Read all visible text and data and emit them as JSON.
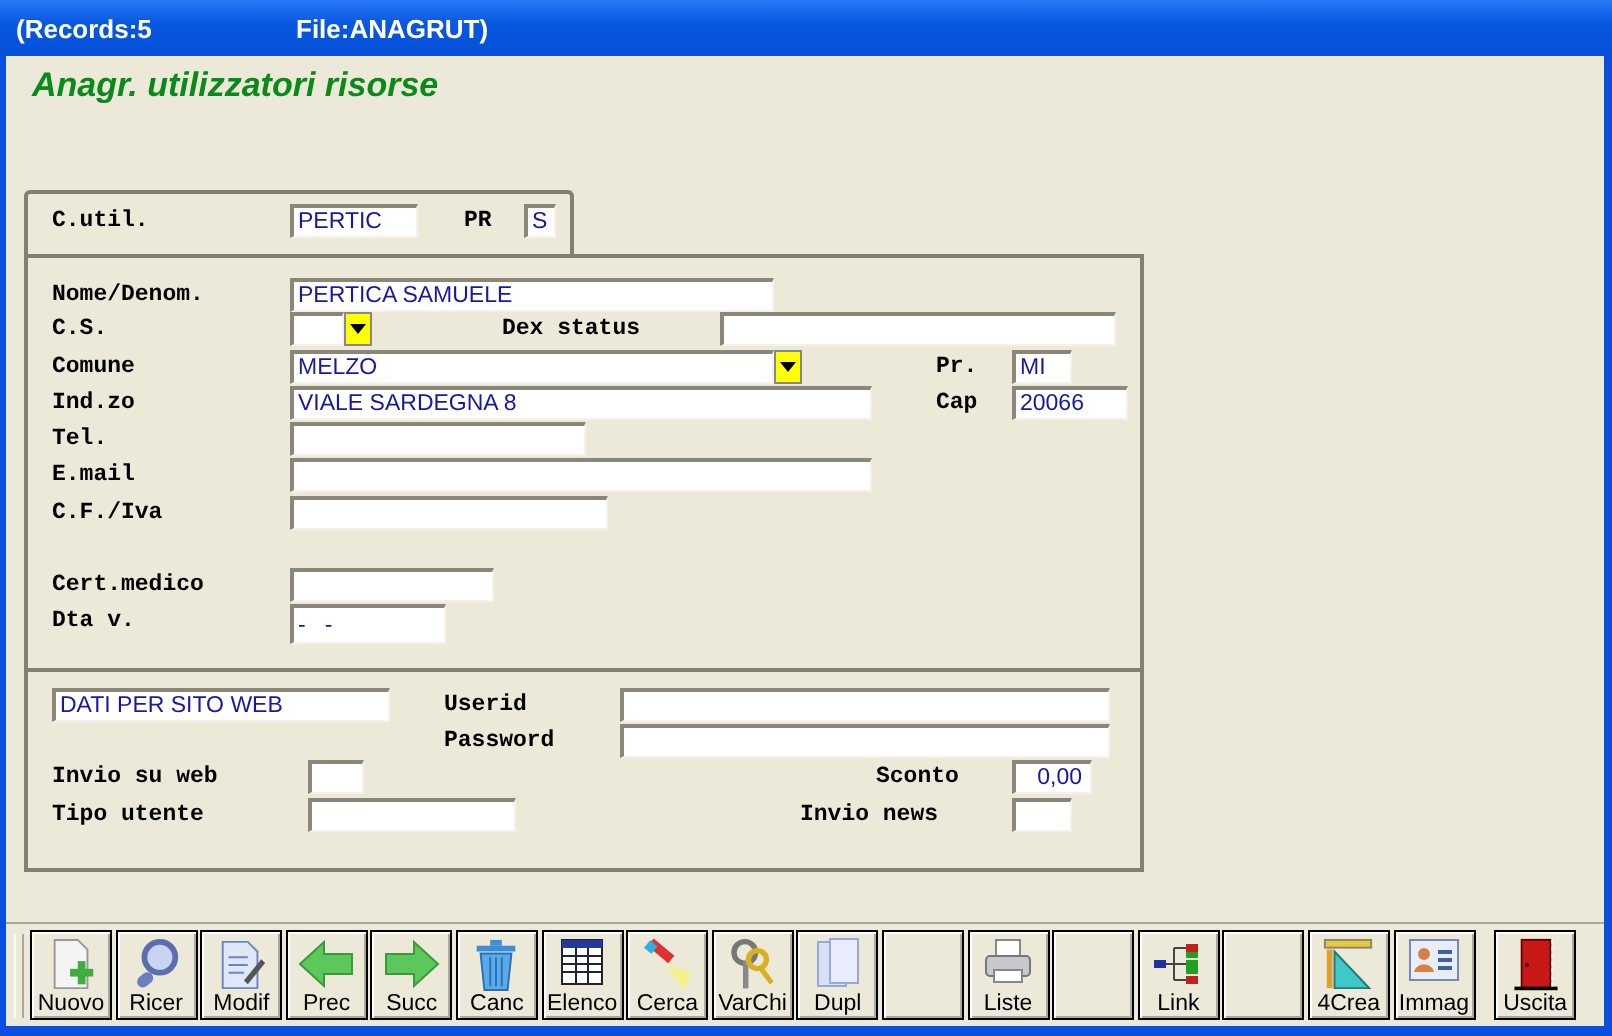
{
  "window": {
    "records": "(Records:5",
    "file": "File:ANAGRUT)"
  },
  "heading": "Anagr. utilizzatori risorse",
  "key_panel": {
    "rows": [
      [
        {
          "kind": "label",
          "text": "C.util."
        },
        {
          "kind": "field",
          "value": "PERTIC"
        },
        {
          "kind": "label",
          "text": "PR"
        },
        {
          "kind": "field",
          "value": "S"
        }
      ]
    ]
  },
  "detail_panel": {
    "rows": [
      [
        {
          "kind": "label",
          "text": "Nome/Denom."
        },
        {
          "kind": "field",
          "value": "PERTICA SAMUELE"
        }
      ],
      [
        {
          "kind": "label",
          "text": "C.S."
        },
        {
          "kind": "field"
        },
        {
          "kind": "dropdown"
        },
        {
          "kind": "label",
          "text": "Dex status"
        },
        {
          "kind": "field"
        }
      ],
      [
        {
          "kind": "label",
          "text": "Comune"
        },
        {
          "kind": "field",
          "value": "MELZO"
        },
        {
          "kind": "dropdown"
        },
        {
          "kind": "label",
          "text": "Pr."
        },
        {
          "kind": "field",
          "value": "MI"
        }
      ],
      [
        {
          "kind": "label",
          "text": "Ind.zo"
        },
        {
          "kind": "field",
          "value": "VIALE SARDEGNA 8"
        },
        {
          "kind": "gap"
        },
        {
          "kind": "label",
          "text": "Cap"
        },
        {
          "kind": "field",
          "value": "20066"
        }
      ],
      [
        {
          "kind": "label",
          "text": "Tel."
        },
        {
          "kind": "field"
        }
      ],
      [
        {
          "kind": "label",
          "text": "E.mail"
        },
        {
          "kind": "field"
        }
      ],
      [
        {
          "kind": "label",
          "text": "C.F./Iva"
        },
        {
          "kind": "field"
        }
      ],
      [
        {
          "kind": "label",
          "text": "Cert.medico"
        },
        {
          "kind": "field"
        }
      ],
      [
        {
          "kind": "label",
          "text": "Dta v."
        },
        {
          "kind": "field",
          "value": "-   -"
        }
      ]
    ]
  },
  "web_panel": {
    "rows": [
      [
        {
          "kind": "field",
          "value": "DATI PER SITO WEB"
        },
        {
          "kind": "label",
          "text": "Userid"
        },
        {
          "kind": "field"
        }
      ],
      [
        {
          "kind": "gap"
        },
        {
          "kind": "label",
          "text": "Password"
        },
        {
          "kind": "field"
        }
      ],
      [
        {
          "kind": "label",
          "text": "Invio su web"
        },
        {
          "kind": "field"
        },
        {
          "kind": "label",
          "text": "Sconto"
        },
        {
          "kind": "field",
          "value": "0,00"
        }
      ],
      [
        {
          "kind": "label",
          "text": "Tipo utente"
        },
        {
          "kind": "field"
        },
        {
          "kind": "label",
          "text": "Invio news"
        },
        {
          "kind": "field"
        }
      ]
    ]
  },
  "toolbar": [
    {
      "kind": "command",
      "label": "Nuovo"
    },
    {
      "kind": "command",
      "label": "Ricer"
    },
    {
      "kind": "command",
      "label": "Modif"
    },
    {
      "kind": "command",
      "label": "Prec"
    },
    {
      "kind": "command",
      "label": "Succ"
    },
    {
      "kind": "command",
      "label": "Canc"
    },
    {
      "kind": "command",
      "label": "Elenco"
    },
    {
      "kind": "command",
      "label": "Cerca"
    },
    {
      "kind": "command",
      "label": "VarChi"
    },
    {
      "kind": "command",
      "label": "Dupl"
    },
    {
      "kind": "blank"
    },
    {
      "kind": "command",
      "label": "Liste"
    },
    {
      "kind": "blank"
    },
    {
      "kind": "command",
      "label": "Link"
    },
    {
      "kind": "blank"
    },
    {
      "kind": "command",
      "label": "4Crea"
    },
    {
      "kind": "command",
      "label": "Immag"
    }
  ],
  "exit_button": {
    "label": "Uscita"
  }
}
